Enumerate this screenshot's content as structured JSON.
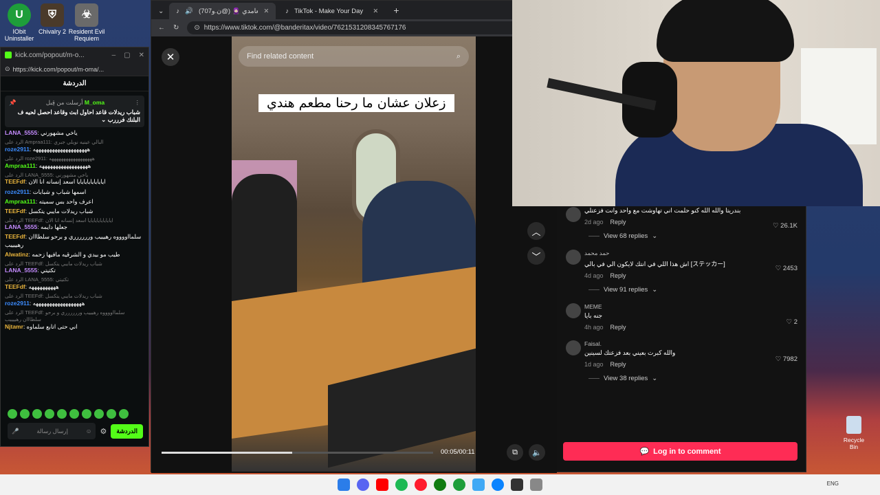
{
  "desktop": {
    "icons": [
      {
        "label": "IObit Uninstaller",
        "icon": "iobit-icon",
        "color": "#1e9e3a"
      },
      {
        "label": "Chivalry 2",
        "icon": "chivalry-icon",
        "color": "#4a3a2a"
      },
      {
        "label": "Resident Evil Requiem",
        "icon": "resident-evil-icon",
        "color": "#6a6a6a"
      }
    ],
    "recycle_bin": "Recycle Bin"
  },
  "kick": {
    "title": "kick.com/popout/m-o...",
    "url": "https://kick.com/popout/m-oma/...",
    "chat_header": "الدردشة",
    "pinned": {
      "by_label": "أرسلت من قِبل",
      "user": "M_oma",
      "message": "شباب ريدلات قاعد احاول ابث وقاعد احصل لحيه ف البلنك فرررب"
    },
    "messages": [
      {
        "user": "LANA_5555",
        "text": "ياخي مشهورني",
        "color": "#c58cff"
      },
      {
        "reply": "الرد على Ampraa111: البالي عينيه نويلي جبري",
        "user": "roze2911",
        "text": "ههههههههههههههههههههه",
        "color": "#3c8cff"
      },
      {
        "reply": "الرد على roze2911: ههههههههههههههههههه",
        "user": "Ampraa111",
        "text": "ههههههههههههههههههه",
        "color": "#53fc18"
      },
      {
        "reply": "الرد على LANA_5555: ياخي مشهورني",
        "user": "TEEFdf",
        "text": "ايايايايايايايايا اسعد إنسانه انا الان",
        "color": "#e9b43c"
      },
      {
        "user": "roze2911",
        "text": "اسمها شباب و شبابات",
        "color": "#3c8cff"
      },
      {
        "user": "Ampraa111",
        "text": "اعرف واحد بس سميته",
        "color": "#53fc18"
      },
      {
        "user": "TEEFdf",
        "text": "شباب ريدلات مايبي يتكسل",
        "color": "#e9b43c"
      },
      {
        "reply": "الرد على TEEFdf: ايايايايايايايايا اسعد إنسانه انا الان",
        "user": "LANA_5555",
        "text": "جعلها دايمه",
        "color": "#c58cff"
      },
      {
        "user": "TEEFdf",
        "text": "سلمااووووه رهيييب ورررررري و برحو سلطااان رهييييب",
        "color": "#e9b43c"
      },
      {
        "user": "Alwatinz",
        "text": "طيب مو بيدي و الشرقيه مافيها زحمه",
        "color": "#e9b43c"
      },
      {
        "reply": "الرد على TEEFdf: شباب ريدلات مايبي يتكسل",
        "user": "LANA_5555",
        "text": "تكتيتي",
        "color": "#c58cff"
      },
      {
        "reply": "الرد على LANA_5555: تكتيتي",
        "user": "TEEFdf",
        "text": "ههههههههههه",
        "color": "#e9b43c"
      },
      {
        "reply": "الرد على TEEFdf: شباب ريدلات مايبي يتكسل",
        "user": "roze2911",
        "text": "ههههههههههههههههههه",
        "color": "#3c8cff"
      },
      {
        "reply": "الرد على TEEFdf: سلمااووووه رهيييب ورررررري و برحو سلطااان رهييييب",
        "user": "Njtamr",
        "text": "اني حتى اتابع سلماوه",
        "color": "#e9b43c"
      }
    ],
    "input_placeholder": "إرسال رسالة",
    "send_label": "الدردشة"
  },
  "browser": {
    "tabs": [
      {
        "label": "(محمد العامدي 🧕🏻 (@ن.و707",
        "active": true
      },
      {
        "label": "TikTok - Make Your Day",
        "active": false
      }
    ],
    "url": "https://www.tiktok.com/@banderitax/video/7621531208345767176"
  },
  "video": {
    "search_placeholder": "Find related content",
    "caption": "زعلان عشان ما رحنا مطعم هندي",
    "time": "00:05/00:11",
    "progress_fraction": 0.48
  },
  "comments": [
    {
      "name": "",
      "text": "بندريتا والله الله كنو حلمت اني تهاوشت مع واحد وانت فزعتلي",
      "age": "2d ago",
      "reply_label": "Reply",
      "likes": "26.1K",
      "replies": "View 68 replies"
    },
    {
      "name": "حمد محمد",
      "text": "اش هذا اللي في انتك لايكون الي في بالي [ステッカー]",
      "age": "4d ago",
      "reply_label": "Reply",
      "likes": "2453",
      "replies": "View 91 replies"
    },
    {
      "name": "MEME",
      "text": "جنه بايا",
      "age": "4h ago",
      "reply_label": "Reply",
      "likes": "2",
      "replies": ""
    },
    {
      "name": "Faisal.",
      "text": "والله كبرت بعيني بعد فزعتك لسينين",
      "age": "1d ago",
      "reply_label": "Reply",
      "likes": "7982",
      "replies": "View 38 replies"
    }
  ],
  "login_label": "Log in to comment",
  "tray": {
    "lang": "ENG"
  }
}
